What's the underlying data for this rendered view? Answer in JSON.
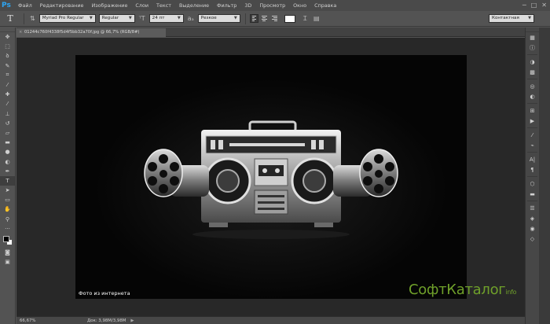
{
  "app": {
    "logo": "Ps"
  },
  "menu": [
    "Файл",
    "Редактирование",
    "Изображение",
    "Слои",
    "Текст",
    "Выделение",
    "Фильтр",
    "3D",
    "Просмотр",
    "Окно",
    "Справка"
  ],
  "window_controls": [
    "─",
    "□",
    "✕"
  ],
  "options": {
    "tool_glyph": "T",
    "font_family": "Myriad Pro Regular",
    "font_style": "Regular",
    "font_size": "24 пт",
    "antialias": "Резкое",
    "text_color": "#ffffff",
    "workspace": "Контактная"
  },
  "document": {
    "tab_title": "01244c760f4338f5d4f5bb32a70f.jpg @ 66,7% (RGB/8#)",
    "tab_close": "×",
    "caption": "Фото из интернета"
  },
  "status": {
    "zoom": "66,67%",
    "doc_info": "Док: 3,98M/3,98M",
    "arrow": "▶"
  },
  "watermark": {
    "main": "СофтКаталог",
    "sub": "info"
  },
  "colors": {
    "foreground": "#000000",
    "background": "#ffffff"
  }
}
